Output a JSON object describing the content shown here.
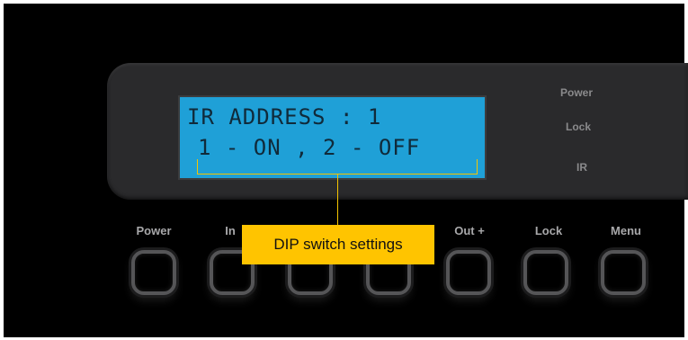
{
  "lcd": {
    "line1": "IR ADDRESS : 1",
    "line2": "1 - ON , 2 - OFF"
  },
  "indicators": {
    "power": "Power",
    "lock": "Lock",
    "ir": "IR"
  },
  "buttons": {
    "power": "Power",
    "in": "In",
    "out_plus": "Out +",
    "lock": "Lock",
    "menu": "Menu"
  },
  "callout": {
    "text": "DIP switch settings"
  },
  "colors": {
    "lcd_background": "#1fa0d7",
    "callout_background": "#ffc400",
    "callout_line": "#f5c400",
    "panel": "#2a2a2c"
  }
}
